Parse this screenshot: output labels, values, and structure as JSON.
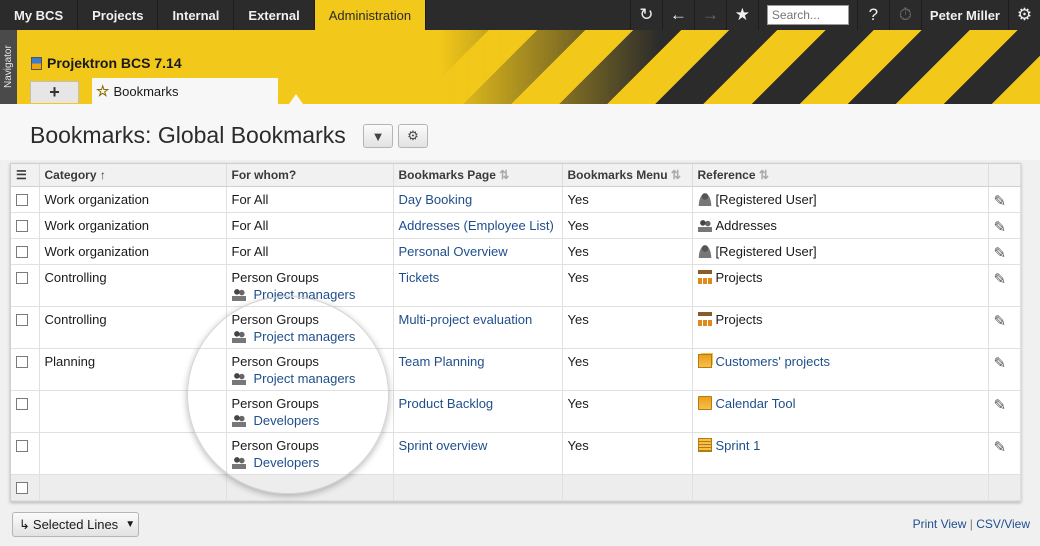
{
  "topnav": {
    "tabs": [
      {
        "label": "My BCS",
        "active": false
      },
      {
        "label": "Projects",
        "active": false
      },
      {
        "label": "Internal",
        "active": false
      },
      {
        "label": "External",
        "active": false
      },
      {
        "label": "Administration",
        "active": true
      }
    ],
    "search_placeholder": "Search...",
    "user": "Peter Miller",
    "help_label": "?"
  },
  "navigator_label": "Navigator",
  "banner": {
    "product": "Projektron BCS 7.14",
    "add_tab_label": "+",
    "active_tab_label": "Bookmarks"
  },
  "page": {
    "title": "Bookmarks: Global Bookmarks"
  },
  "table": {
    "columns": [
      "Category",
      "For whom?",
      "Bookmarks Page",
      "Bookmarks Menu",
      "Reference"
    ],
    "rows": [
      {
        "category": "Work organization",
        "for_whom": "For All",
        "for_whom_sub": "",
        "page": "Day Booking",
        "menu": "Yes",
        "reference": "[Registered User]",
        "ref_icon": "user-icon",
        "ref_link": false
      },
      {
        "category": "Work organization",
        "for_whom": "For All",
        "for_whom_sub": "",
        "page": "Addresses (Employee List)",
        "menu": "Yes",
        "reference": "Addresses",
        "ref_icon": "people-icon",
        "ref_link": false
      },
      {
        "category": "Work organization",
        "for_whom": "For All",
        "for_whom_sub": "",
        "page": "Personal Overview",
        "menu": "Yes",
        "reference": "[Registered User]",
        "ref_icon": "user-icon",
        "ref_link": false
      },
      {
        "category": "Controlling",
        "for_whom": "Person Groups",
        "for_whom_sub": "Project managers",
        "page": "Tickets",
        "menu": "Yes",
        "reference": "Projects",
        "ref_icon": "projects-icon",
        "ref_link": false
      },
      {
        "category": "Controlling",
        "for_whom": "Person Groups",
        "for_whom_sub": "Project managers",
        "page": "Multi-project evaluation",
        "menu": "Yes",
        "reference": "Projects",
        "ref_icon": "projects-icon",
        "ref_link": false
      },
      {
        "category": "Planning",
        "for_whom": "Person Groups",
        "for_whom_sub": "Project managers",
        "page": "Team Planning",
        "menu": "Yes",
        "reference": "Customers' projects",
        "ref_icon": "folders-icon",
        "ref_link": true
      },
      {
        "category": "",
        "for_whom": "Person Groups",
        "for_whom_sub": "Developers",
        "page": "Product Backlog",
        "menu": "Yes",
        "reference": "Calendar Tool",
        "ref_icon": "folder-icon",
        "ref_link": true
      },
      {
        "category": "",
        "for_whom": "Person Groups",
        "for_whom_sub": "Developers",
        "page": "Sprint overview",
        "menu": "Yes",
        "reference": "Sprint 1",
        "ref_icon": "sprint-icon",
        "ref_link": true
      }
    ]
  },
  "footer": {
    "selected_lines_label": "Selected Lines",
    "print_view": "Print View",
    "separator": "|",
    "csv_view": "CSV/View"
  },
  "colors": {
    "accent_yellow": "#f2c81a",
    "topbar": "#2b2b2b",
    "link": "#1f4e8c"
  }
}
